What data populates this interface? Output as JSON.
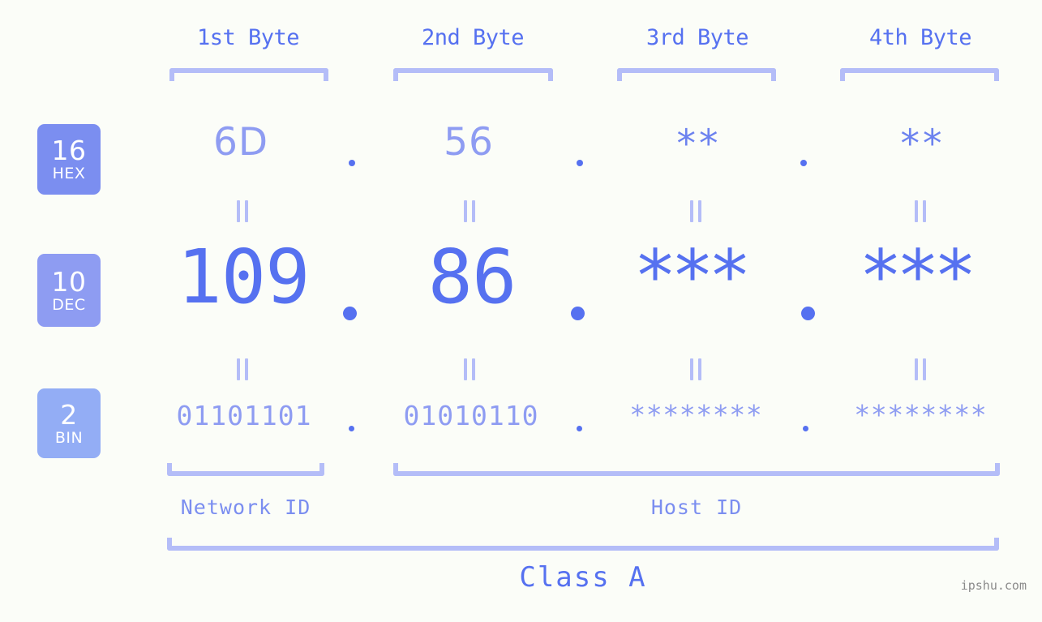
{
  "meta": {
    "background_color": "#fbfdf8",
    "accent_strong": "#5671f0",
    "accent_mid": "#8e9cf2",
    "accent_light": "#b4bdf8",
    "watermark_color": "#8a8a8a"
  },
  "headers": [
    {
      "label": "1st Byte"
    },
    {
      "label": "2nd Byte"
    },
    {
      "label": "3rd Byte"
    },
    {
      "label": "4th Byte"
    }
  ],
  "bases": [
    {
      "number": "16",
      "name": "HEX",
      "color": "#7b8ef0"
    },
    {
      "number": "10",
      "name": "DEC",
      "color": "#8e9cf2"
    },
    {
      "number": "2",
      "name": "BIN",
      "color": "#93adf5"
    }
  ],
  "rows": {
    "hex": {
      "values": [
        "6D",
        "56",
        "**",
        "**"
      ],
      "masked": [
        false,
        false,
        true,
        true
      ],
      "separator": "."
    },
    "dec": {
      "values": [
        "109",
        "86",
        "***",
        "***"
      ],
      "masked": [
        false,
        false,
        true,
        true
      ],
      "separator": "."
    },
    "bin": {
      "values": [
        "01101101",
        "01010110",
        "********",
        "********"
      ],
      "masked": [
        false,
        false,
        true,
        true
      ],
      "separator": "."
    }
  },
  "equals_symbol": "‖",
  "segments": {
    "network_id": "Network ID",
    "host_id": "Host ID",
    "class": "Class A"
  },
  "watermark": "ipshu.com"
}
